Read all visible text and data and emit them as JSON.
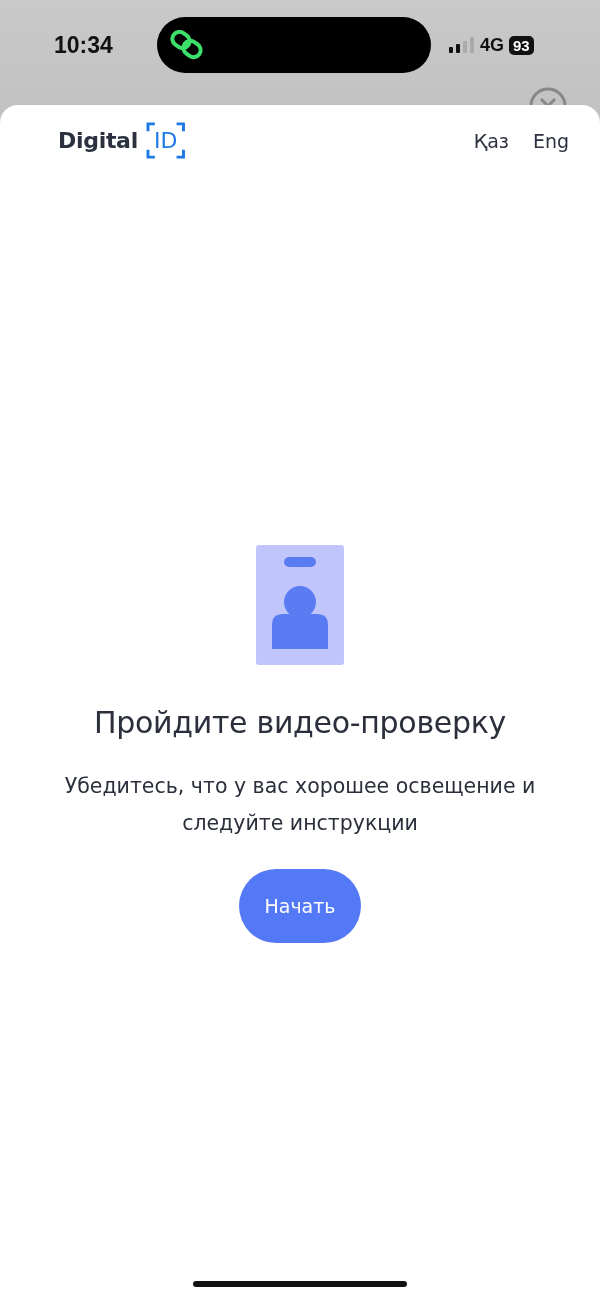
{
  "status_bar": {
    "time": "10:34",
    "network": "4G",
    "battery": "93"
  },
  "header": {
    "logo_text": "Digital",
    "logo_badge": "ID",
    "languages": [
      {
        "label": "Қаз"
      },
      {
        "label": "Eng"
      }
    ]
  },
  "content": {
    "title": "Пройдите видео-проверку",
    "subtitle": "Убедитесь, что у вас хорошее освещение и следуйте инструкции",
    "button": "Начать"
  }
}
